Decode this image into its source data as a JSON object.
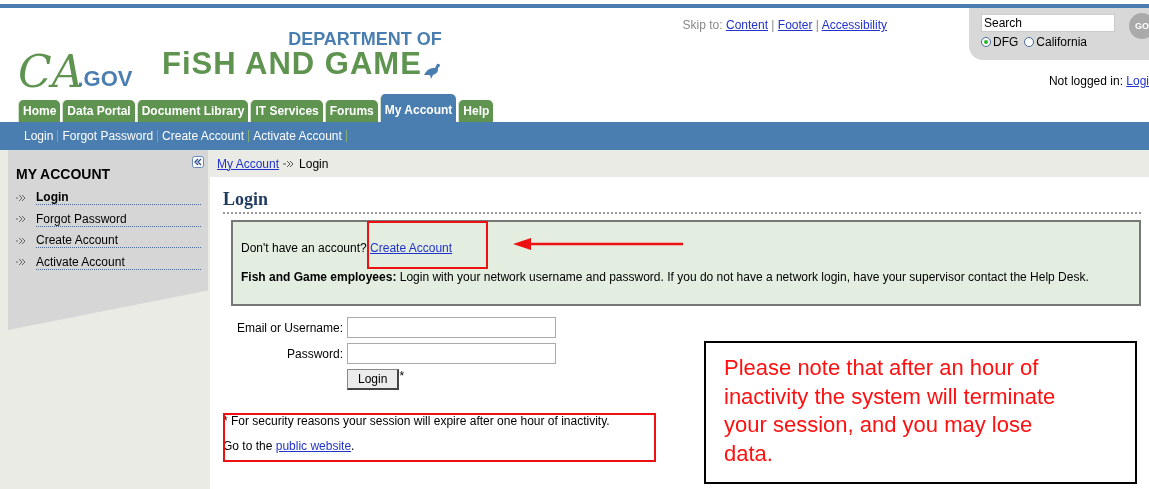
{
  "header": {
    "dept": "DEPARTMENT OF",
    "name": "FiSH AND GAME",
    "logo_ca": "CA",
    "logo_gov": ".GOV",
    "skip_label": "Skip to:",
    "skip_links": [
      "Content",
      "Footer",
      "Accessibility"
    ],
    "skip_separator": "|",
    "search": {
      "value": "Search",
      "go": "GO",
      "scopes": [
        {
          "label": "DFG",
          "selected": true
        },
        {
          "label": "California",
          "selected": false
        }
      ]
    },
    "login_status": "Not logged in:",
    "login_link": "Logi"
  },
  "tabs": [
    {
      "label": "Home",
      "selected": false
    },
    {
      "label": "Data Portal",
      "selected": false
    },
    {
      "label": "Document Library",
      "selected": false
    },
    {
      "label": "IT Services",
      "selected": false
    },
    {
      "label": "Forums",
      "selected": false
    },
    {
      "label": "My Account",
      "selected": true
    },
    {
      "label": "Help",
      "selected": false
    }
  ],
  "subnav": [
    "Login",
    "Forgot Password",
    "Create Account",
    "Activate Account"
  ],
  "sidebar": {
    "title": "MY ACCOUNT",
    "items": [
      {
        "label": "Login",
        "selected": true
      },
      {
        "label": "Forgot Password",
        "selected": false
      },
      {
        "label": "Create Account",
        "selected": false
      },
      {
        "label": "Activate Account",
        "selected": false
      }
    ]
  },
  "breadcrumb": {
    "link": "My Account",
    "current": "Login"
  },
  "page_title": "Login",
  "notice": {
    "question": "Don't have an account?",
    "link": "Create Account",
    "employees": "**Fish and Game employees:** Login with your network username and password. If you do not have a network login, have your supervisor contact the Help Desk."
  },
  "form": {
    "fields": [
      {
        "label": "Email or Username:"
      },
      {
        "label": "Password:"
      }
    ],
    "button": "Login",
    "button_note": "*"
  },
  "footnote": "* For security reasons your session will expire after one hour of inactivity.",
  "public": {
    "before": "Go to the",
    "link": "public website",
    "after": "."
  },
  "callout": "Please note that after an hour of inactivity the system will terminate your session, and you may lose data."
}
